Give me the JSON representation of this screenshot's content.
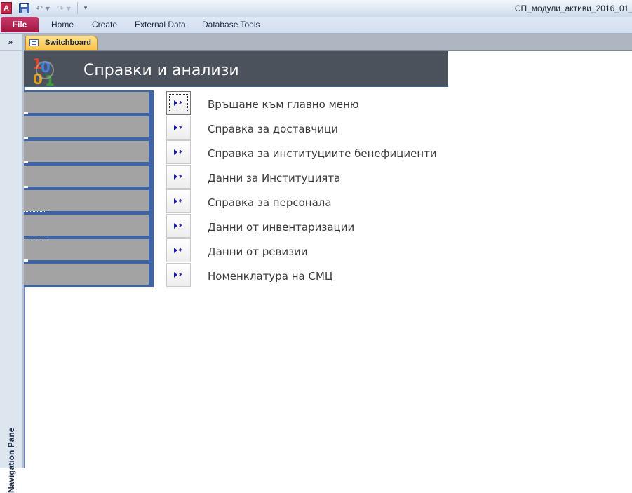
{
  "titlebar": {
    "app_icon_letter": "A",
    "title": "СП_модули_активи_2016_01_"
  },
  "ribbon": {
    "file_label": "File",
    "tabs": [
      {
        "label": "Home"
      },
      {
        "label": "Create"
      },
      {
        "label": "External Data"
      },
      {
        "label": "Database Tools"
      }
    ]
  },
  "nav_pane": {
    "toggle_glyph": "»",
    "label": "Navigation Pane"
  },
  "document": {
    "tab_label": "Switchboard"
  },
  "form": {
    "title": "Справки и анализи",
    "items": [
      {
        "label": "Връщане към главно меню"
      },
      {
        "label": "Справка за доставчици"
      },
      {
        "label": "Справка за институциите бенефициенти"
      },
      {
        "label": "Данни за Институцията"
      },
      {
        "label": "Справка за персонала"
      },
      {
        "label": "Данни от инвентаризации"
      },
      {
        "label": "Данни от ревизии"
      },
      {
        "label": "Номенклатура на СМЦ"
      }
    ]
  },
  "colors": {
    "header_bg": "#4b525c",
    "panel_blue": "#3e64a6",
    "band_gray": "#a3a3a3",
    "file_tab": "#b6244f",
    "doc_tab": "#f9c247",
    "button_icon": "#1a1aa8"
  }
}
